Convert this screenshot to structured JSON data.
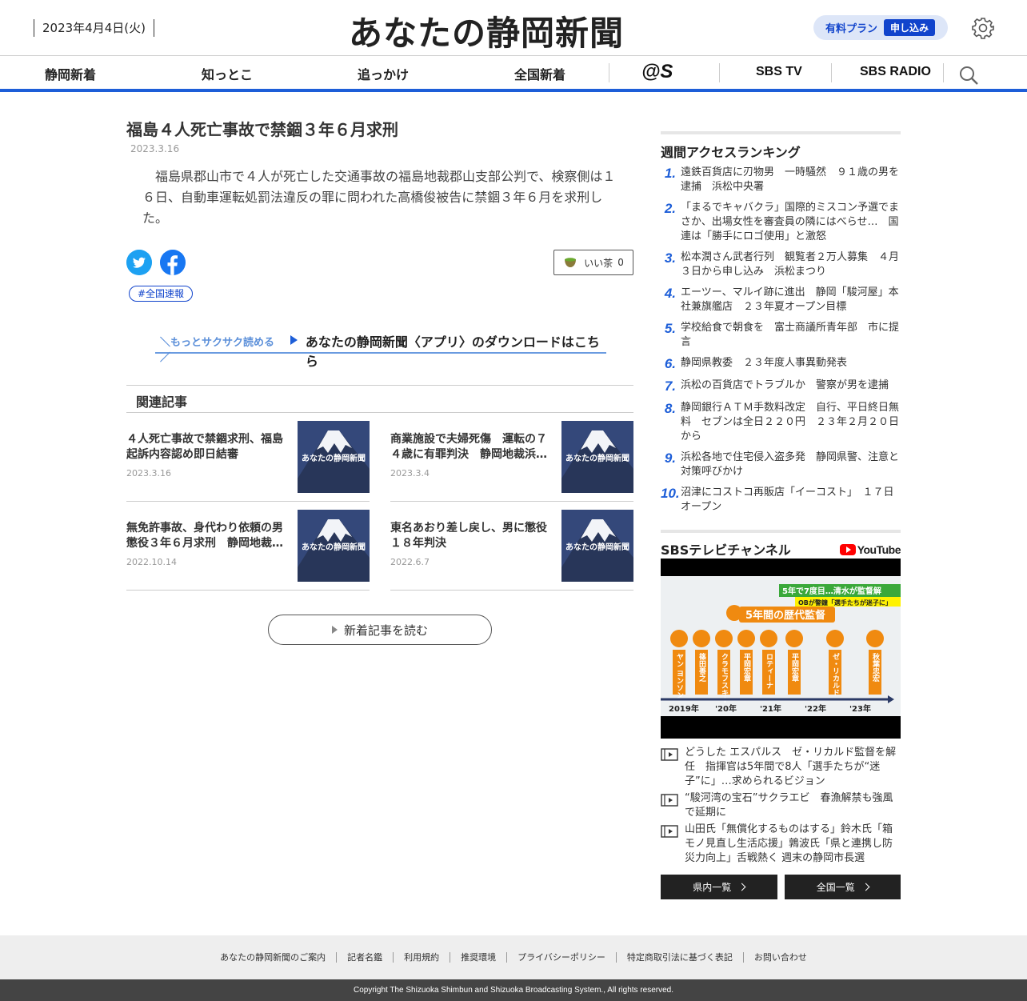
{
  "header": {
    "date": "2023年4月4日(火)",
    "logo": "あなたの静岡新聞",
    "plan_label": "有料プラン",
    "plan_button": "申し込み"
  },
  "nav": {
    "items": [
      "静岡新着",
      "知っとこ",
      "追っかけ",
      "全国新着"
    ],
    "at_s": "@S",
    "sbs_tv": "SBS TV",
    "sbs_radio": "SBS RADIO"
  },
  "article": {
    "title": "福島４人死亡事故で禁錮３年６月求刑",
    "date": "2023.3.16",
    "body": "福島県郡山市で４人が死亡した交通事故の福島地裁郡山支部公判で、検察側は１６日、自動車運転処罰法違反の罪に問われた高橋俊被告に禁錮３年６月を求刑した。",
    "iicha_label": "いい茶",
    "iicha_count": "0",
    "tag": "#全国速報"
  },
  "app_banner": {
    "small": "＼もっとサクサク読める／",
    "main": "あなたの静岡新聞〈アプリ〉のダウンロードはこちら"
  },
  "related": {
    "heading": "関連記事",
    "thumb_text": "あなたの静岡新聞",
    "items": [
      {
        "title": "４人死亡事故で禁錮求刑、福島　起訴内容認め即日結審",
        "date": "2023.3.16"
      },
      {
        "title": "商業施設で夫婦死傷　運転の７４歳に有罪判決　静岡地裁浜…",
        "date": "2023.3.4"
      },
      {
        "title": "無免許事故、身代わり依頼の男　懲役３年６月求刑　静岡地裁…",
        "date": "2022.10.14"
      },
      {
        "title": "東名あおり差し戻し、男に懲役１８年判決",
        "date": "2022.6.7"
      }
    ],
    "more_button": "新着記事を読む"
  },
  "ranking": {
    "title": "週間アクセスランキング",
    "items": [
      {
        "num": "1.",
        "text": "遠鉄百貨店に刃物男　一時騒然　９１歳の男を逮捕　浜松中央署"
      },
      {
        "num": "2.",
        "text": "「まるでキャバクラ」国際的ミスコン予選でまさか、出場女性を審査員の隣にはべらせ…　国連は「勝手にロゴ使用」と激怒"
      },
      {
        "num": "3.",
        "text": "松本潤さん武者行列　観覧者２万人募集　４月３日から申し込み　浜松まつり"
      },
      {
        "num": "4.",
        "text": "エーツー、マルイ跡に進出　静岡「駿河屋」本社兼旗艦店　２３年夏オープン目標"
      },
      {
        "num": "5.",
        "text": "学校給食で朝食を　富士商議所青年部　市に提言"
      },
      {
        "num": "6.",
        "text": "静岡県教委　２３年度人事異動発表"
      },
      {
        "num": "7.",
        "text": "浜松の百貨店でトラブルか　警察が男を逮捕"
      },
      {
        "num": "8.",
        "text": "静岡銀行ＡＴＭ手数料改定　自行、平日終日無料　セブンは全日２２０円　２３年２月２０日から"
      },
      {
        "num": "9.",
        "text": "浜松各地で住宅侵入盗多発　静岡県警、注意と対策呼びかけ"
      },
      {
        "num": "10.",
        "text": "沼津にコストコ再販店「イーコスト」　１７日オープン"
      }
    ]
  },
  "tv": {
    "title": "SBSテレビチャンネル",
    "youtube": "YouTube",
    "video": {
      "banner1": "5年で7度目…清水が監督解",
      "banner2": "OBが警鐘「選手たちが迷子に」",
      "heading": "5年間の歴代監督",
      "coaches": [
        "ヤン ヨンソン",
        "篠田善之",
        "クラモフスキー",
        "平岡宏章",
        "ロティーナ",
        "平岡宏章",
        "ゼ・リカルド",
        "秋葉忠宏"
      ],
      "years": [
        "2019年",
        "'20年",
        "'21年",
        "'22年",
        "'23年"
      ]
    },
    "items": [
      "どうした エスパルス　ゼ・リカルド監督を解任　指揮官は5年間で8人「選手たちが“迷子”に」…求められるビジョン",
      "“駿河湾の宝石”サクラエビ　春漁解禁も強風で延期に",
      "山田氏「無償化するものはする」鈴木氏「箱モノ見直し生活応援」鶉波氏「県と連携し防災力向上」舌戦熱く 週末の静岡市長選"
    ],
    "btn_local": "県内一覧",
    "btn_national": "全国一覧"
  },
  "footer": {
    "links": [
      "あなたの静岡新聞のご案内",
      "記者名鑑",
      "利用規約",
      "推奨環境",
      "プライバシーポリシー",
      "特定商取引法に基づく表記",
      "お問い合わせ"
    ],
    "copyright": "Copyright The Shizuoka Shimbun and Shizuoka Broadcasting System., All rights reserved."
  },
  "colors": {
    "accent": "#1d5ed8",
    "brand_blue": "#1144cc",
    "twitter": "#1da1f2",
    "facebook": "#1877f2",
    "youtube": "#ff0000"
  }
}
